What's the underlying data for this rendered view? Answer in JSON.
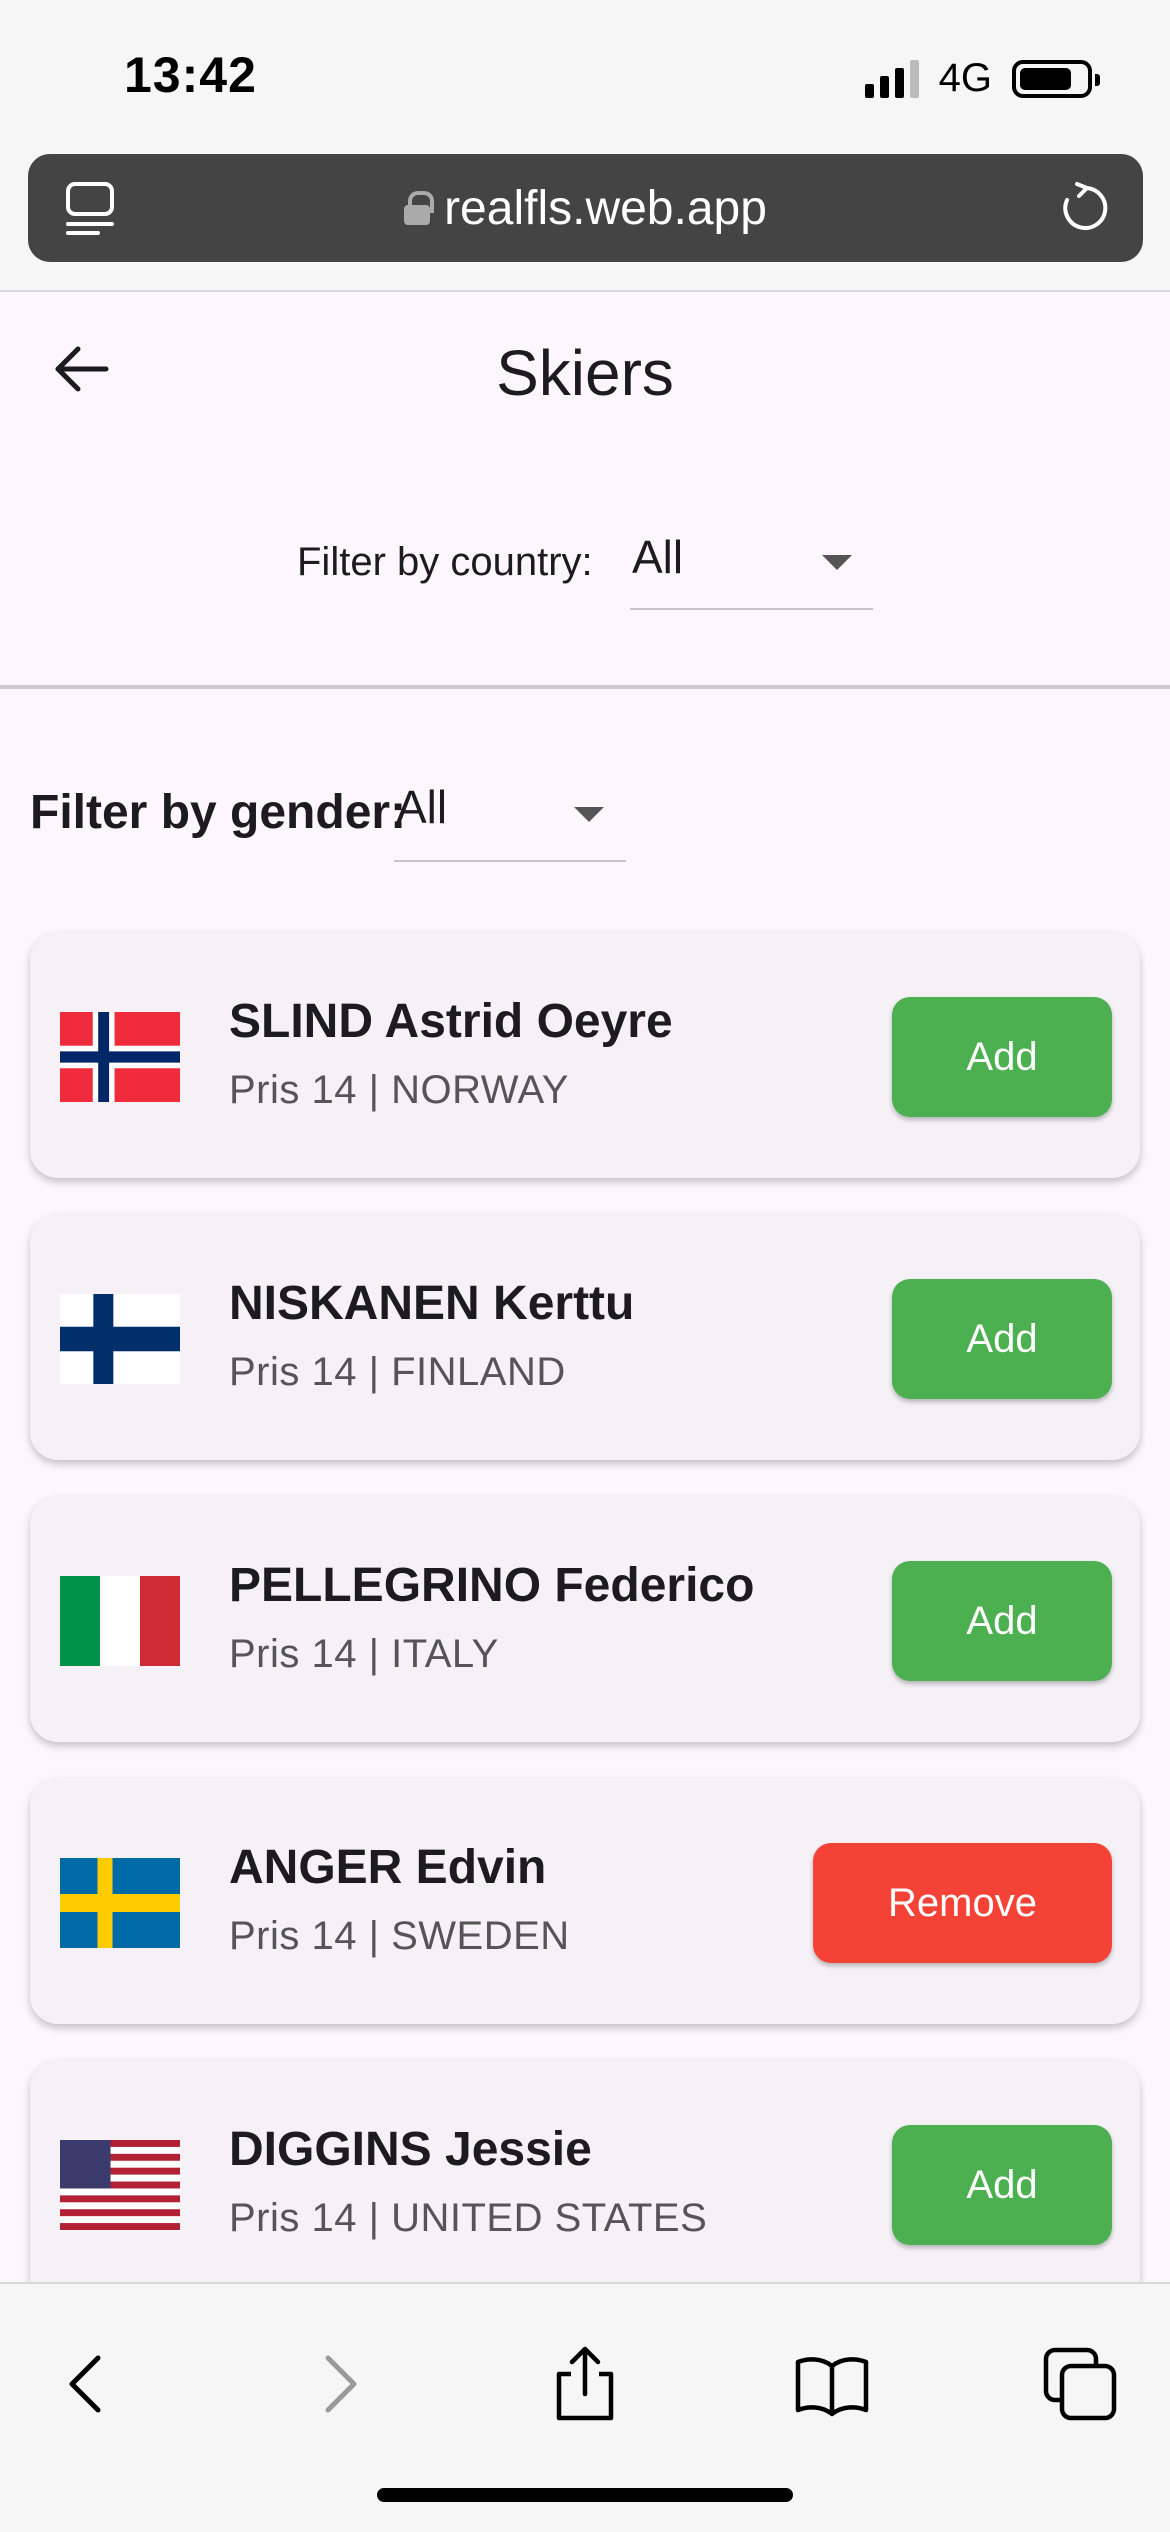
{
  "status_bar": {
    "time": "13:42",
    "network": "4G"
  },
  "browser": {
    "url": "realfls.web.app"
  },
  "app_bar": {
    "title": "Skiers"
  },
  "filters": {
    "country_label": "Filter by country:",
    "country_value": "All",
    "gender_label": "Filter by gender:",
    "gender_value": "All"
  },
  "skiers": [
    {
      "name": "SLIND Astrid Oeyre",
      "subtitle": "Pris 14 | NORWAY",
      "flag": "norway-flag",
      "action": "Add"
    },
    {
      "name": "NISKANEN Kerttu",
      "subtitle": "Pris 14 | FINLAND",
      "flag": "finland-flag",
      "action": "Add"
    },
    {
      "name": "PELLEGRINO Federico",
      "subtitle": "Pris 14 | ITALY",
      "flag": "italy-flag",
      "action": "Add"
    },
    {
      "name": "ANGER Edvin",
      "subtitle": "Pris 14 | SWEDEN",
      "flag": "sweden-flag",
      "action": "Remove"
    },
    {
      "name": "DIGGINS Jessie",
      "subtitle": "Pris 14 | UNITED STATES",
      "flag": "usa-flag",
      "action": "Add"
    }
  ],
  "colors": {
    "add": "#4caf50",
    "remove": "#f44336",
    "background": "#fdf7fd",
    "card": "#f5f1f7"
  }
}
